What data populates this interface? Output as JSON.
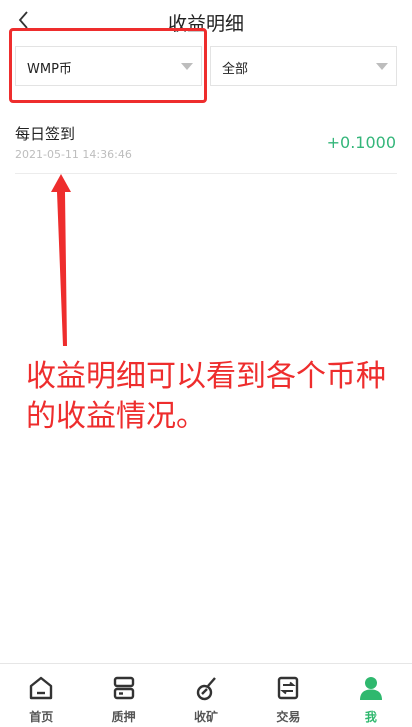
{
  "header": {
    "title": "收益明细",
    "back_icon": "chevron-left-icon"
  },
  "filters": {
    "coin_select": {
      "value": "WMP币"
    },
    "type_select": {
      "value": "全部"
    }
  },
  "records": [
    {
      "name": "每日签到",
      "time": "2021-05-11 14:36:46",
      "amount": "+0.1000"
    }
  ],
  "annotation": {
    "text": "收益明细可以看到各个币种的收益情况。",
    "color": "#ee2d2d"
  },
  "tabbar": {
    "items": [
      {
        "label": "首页",
        "icon": "home-icon"
      },
      {
        "label": "质押",
        "icon": "pledge-icon"
      },
      {
        "label": "收矿",
        "icon": "mining-icon"
      },
      {
        "label": "交易",
        "icon": "trade-icon"
      },
      {
        "label": "我",
        "icon": "profile-icon"
      }
    ],
    "active_color": "#2fb86e"
  },
  "colors": {
    "positive": "#34b67a",
    "accent": "#2fb86e"
  }
}
